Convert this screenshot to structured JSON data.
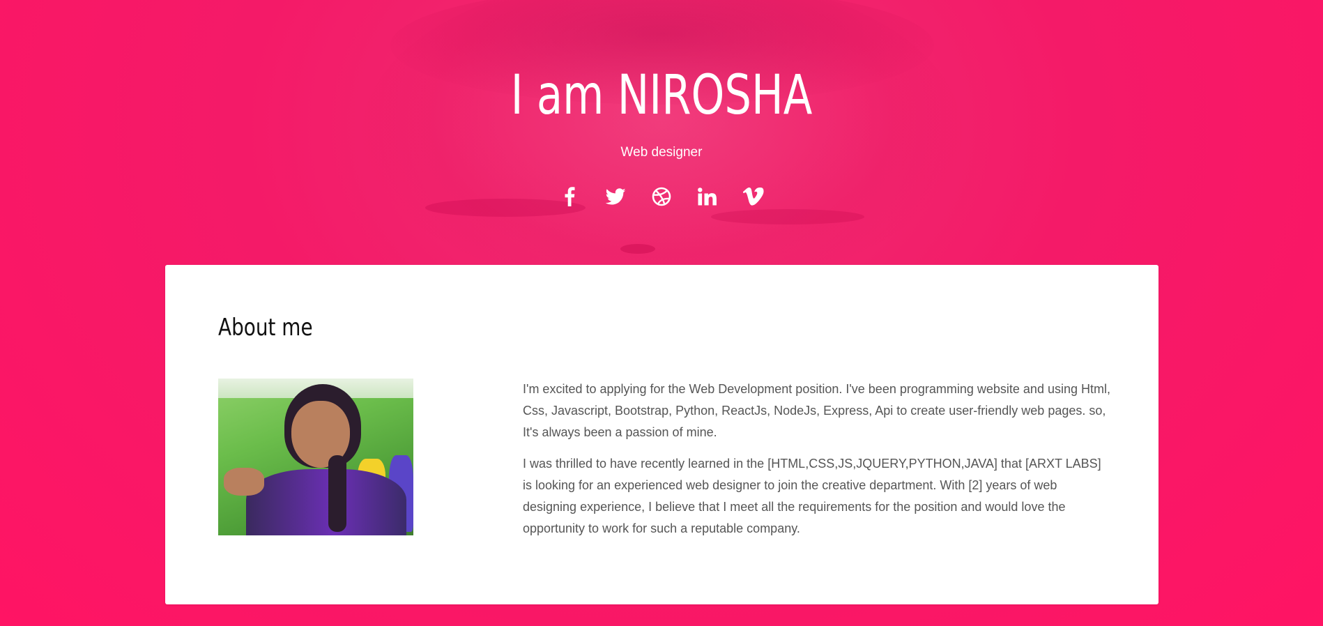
{
  "hero": {
    "title": "I am NIROSHA",
    "subtitle": "Web designer",
    "social_icons": [
      "facebook-icon",
      "twitter-icon",
      "dribbble-icon",
      "linkedin-icon",
      "vimeo-icon"
    ]
  },
  "about": {
    "heading": "About me",
    "paragraphs": [
      "I'm excited to applying for the Web Development position. I've been programming website and using Html, Css, Javascript, Bootstrap, Python, ReactJs, NodeJs, Express, Api to create user-friendly web pages. so, It's always been a passion of mine.",
      "I was thrilled to have recently learned in the [HTML,CSS,JS,JQUERY,PYTHON,JAVA] that [ARXT LABS] is looking for an experienced web designer to join the creative department. With [2] years of web designing experience, I believe that I meet all the requirements for the position and would love the opportunity to work for such a reputable company."
    ]
  },
  "colors": {
    "background": "#ff1464",
    "hero_text": "#ffffff",
    "card": "#ffffff",
    "heading_text": "#111111",
    "body_text": "#555555"
  }
}
